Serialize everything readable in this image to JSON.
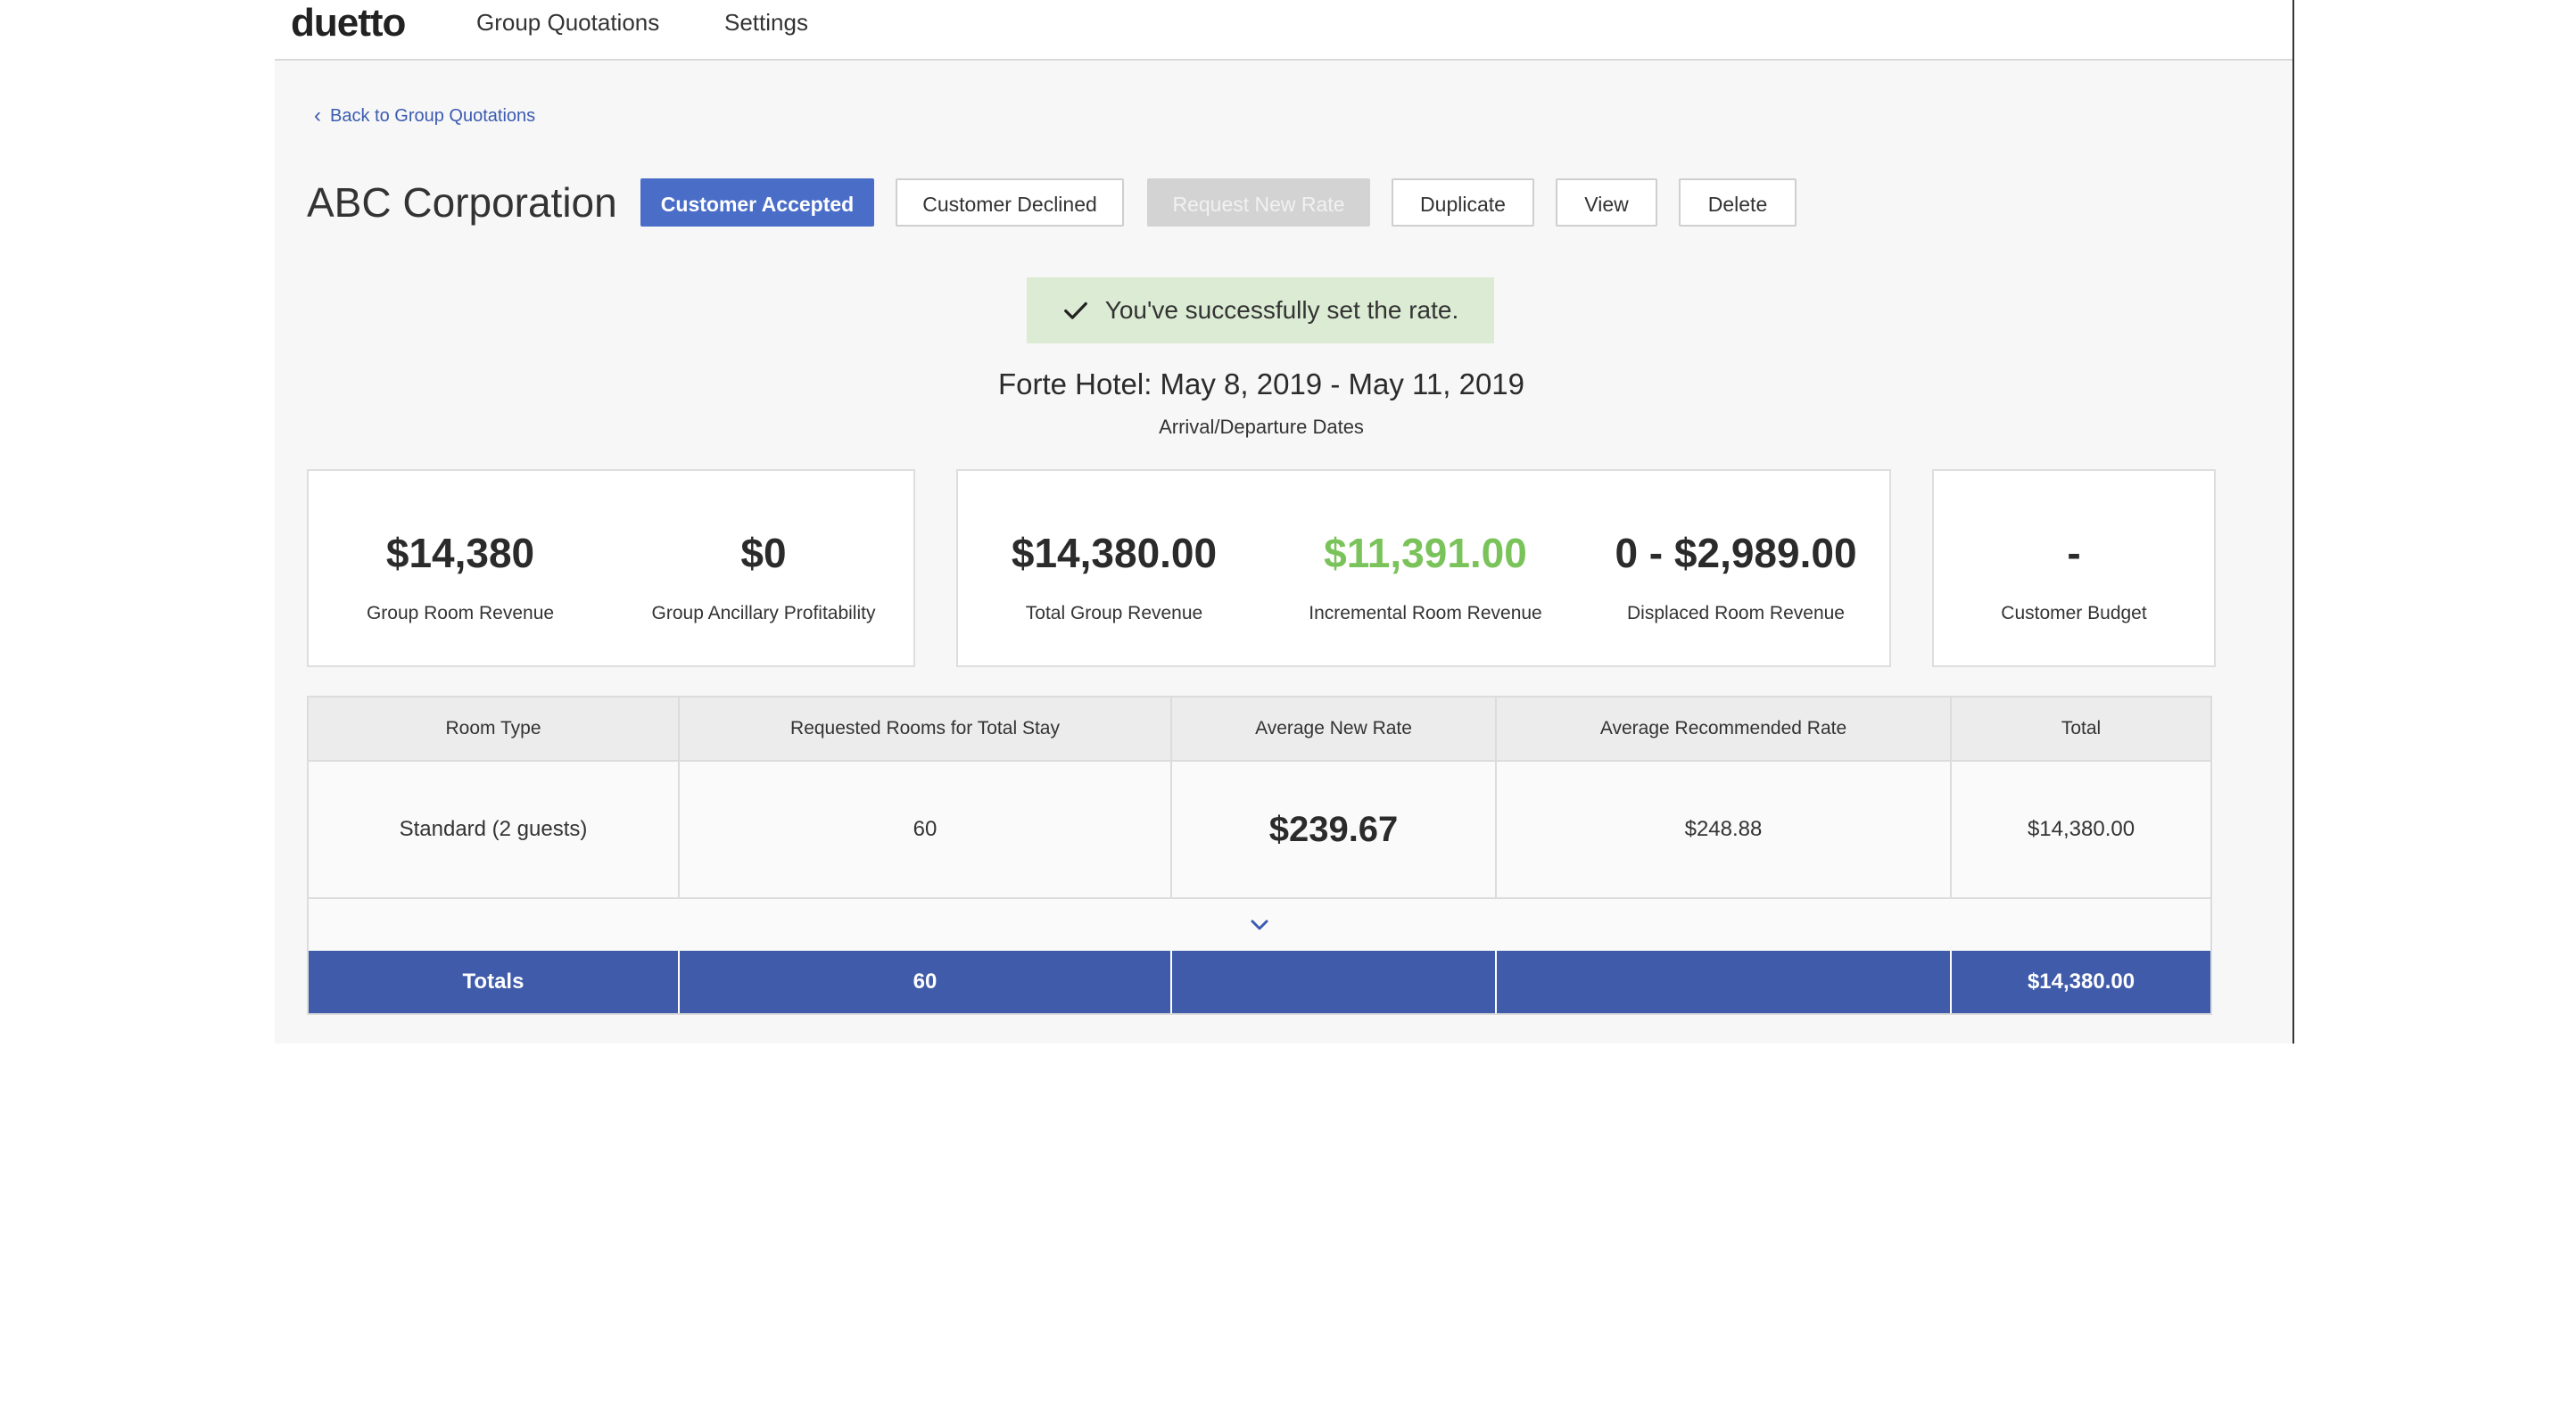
{
  "nav": {
    "logo": "duetto",
    "links": [
      "Group Quotations",
      "Settings"
    ]
  },
  "back_link": "Back to Group Quotations",
  "page_title": "ABC Corporation",
  "actions": {
    "customer_accepted": "Customer Accepted",
    "customer_declined": "Customer Declined",
    "request_new_rate": "Request New Rate",
    "duplicate": "Duplicate",
    "view": "View",
    "delete": "Delete"
  },
  "toast": "You've successfully set the rate.",
  "stay": {
    "title": "Forte Hotel: May 8, 2019 - May 11, 2019",
    "subtitle": "Arrival/Departure Dates"
  },
  "metrics": {
    "group_room_revenue": {
      "value": "$14,380",
      "label": "Group Room Revenue"
    },
    "group_ancillary": {
      "value": "$0",
      "label": "Group Ancillary Profitability"
    },
    "total_group_revenue": {
      "value": "$14,380.00",
      "label": "Total Group Revenue"
    },
    "incremental_room_revenue": {
      "value": "$11,391.00",
      "label": "Incremental Room Revenue"
    },
    "displaced_room_revenue": {
      "value": "0 - $2,989.00",
      "label": "Displaced Room Revenue"
    },
    "customer_budget": {
      "value": "-",
      "label": "Customer Budget"
    }
  },
  "table": {
    "headers": [
      "Room Type",
      "Requested Rooms for Total Stay",
      "Average New Rate",
      "Average Recommended Rate",
      "Total"
    ],
    "rows": [
      [
        "Standard (2 guests)",
        "60",
        "$239.67",
        "$248.88",
        "$14,380.00"
      ]
    ],
    "totals": [
      "Totals",
      "60",
      "",
      "",
      "$14,380.00"
    ]
  },
  "colors": {
    "primary": "#4a6ec8",
    "totals_bar": "#3f5ba9",
    "success_bg": "#dcebd3",
    "positive_green": "#7ac35a",
    "link": "#3b5bb1"
  }
}
